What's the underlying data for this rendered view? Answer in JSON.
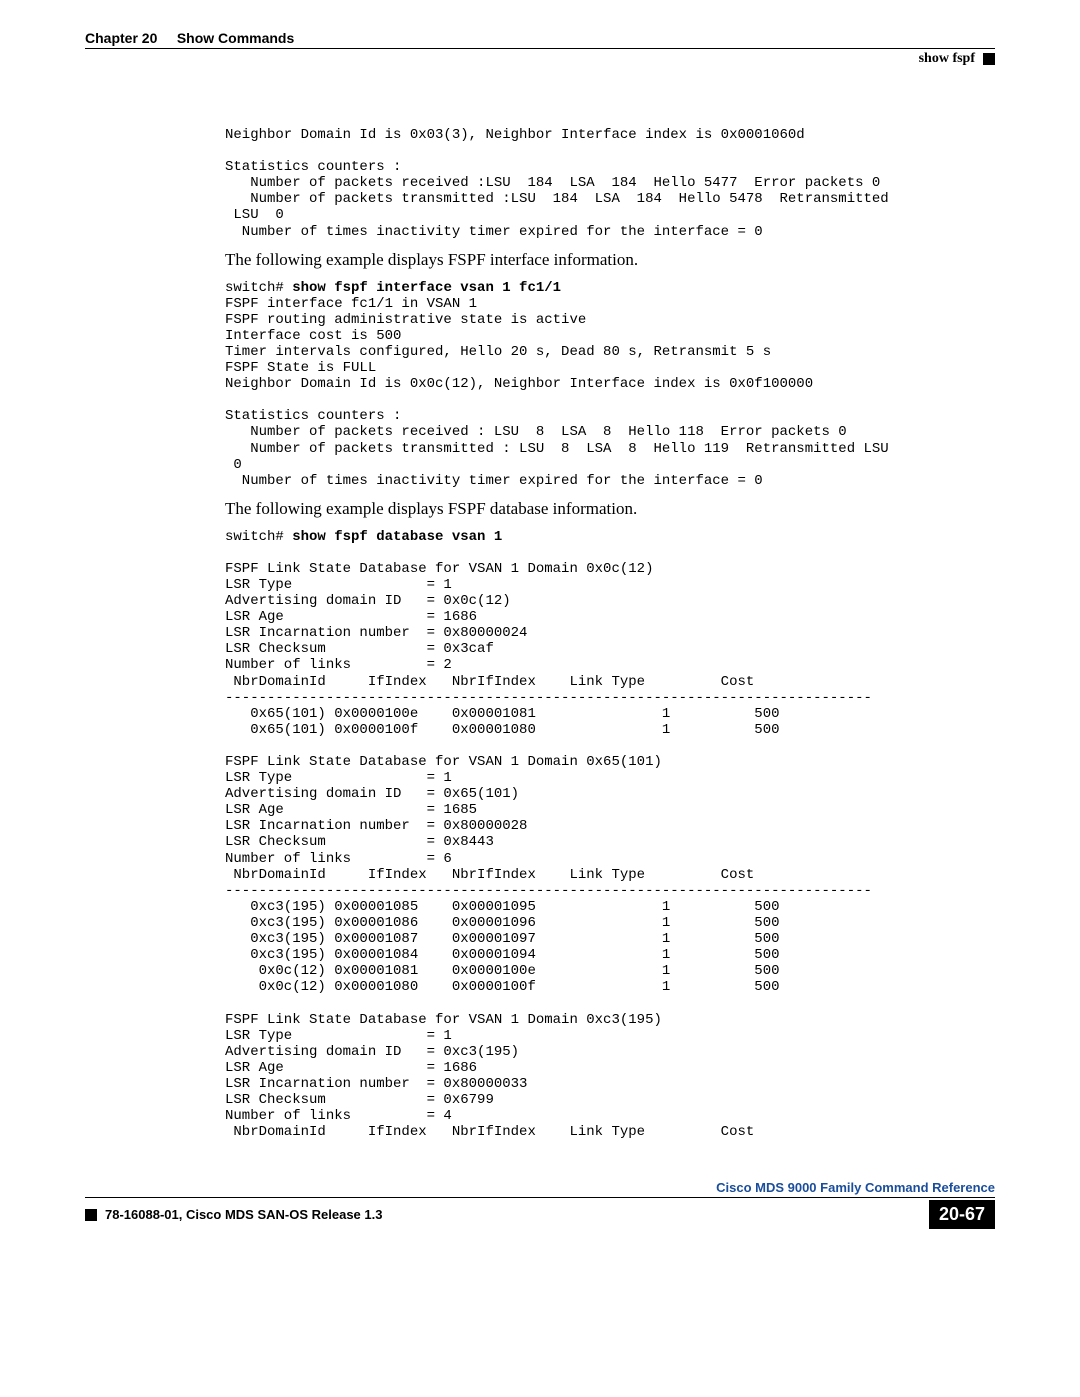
{
  "header": {
    "chapter": "Chapter 20",
    "title": "Show Commands",
    "section": "show fspf"
  },
  "block1": "Neighbor Domain Id is 0x03(3), Neighbor Interface index is 0x0001060d\n\nStatistics counters :\n   Number of packets received :LSU  184  LSA  184  Hello 5477  Error packets 0\n   Number of packets transmitted :LSU  184  LSA  184  Hello 5478  Retransmitted\n LSU  0\n  Number of times inactivity timer expired for the interface = 0",
  "body1": "The following example displays FSPF interface information.",
  "cmd1_prompt": "switch# ",
  "cmd1_cmd": "show fspf interface vsan 1 fc1/1",
  "block2": "FSPF interface fc1/1 in VSAN 1\nFSPF routing administrative state is active\nInterface cost is 500\nTimer intervals configured, Hello 20 s, Dead 80 s, Retransmit 5 s\nFSPF State is FULL\nNeighbor Domain Id is 0x0c(12), Neighbor Interface index is 0x0f100000\n\nStatistics counters :\n   Number of packets received : LSU  8  LSA  8  Hello 118  Error packets 0\n   Number of packets transmitted : LSU  8  LSA  8  Hello 119  Retransmitted LSU\n 0\n  Number of times inactivity timer expired for the interface = 0",
  "body2": "The following example displays FSPF database information.",
  "cmd2_prompt": "switch# ",
  "cmd2_cmd": "show fspf database vsan 1",
  "block3": "\nFSPF Link State Database for VSAN 1 Domain 0x0c(12)\nLSR Type                = 1\nAdvertising domain ID   = 0x0c(12)\nLSR Age                 = 1686\nLSR Incarnation number  = 0x80000024\nLSR Checksum            = 0x3caf\nNumber of links         = 2\n NbrDomainId     IfIndex   NbrIfIndex    Link Type         Cost\n-----------------------------------------------------------------------------\n   0x65(101) 0x0000100e    0x00001081               1          500\n   0x65(101) 0x0000100f    0x00001080               1          500\n\nFSPF Link State Database for VSAN 1 Domain 0x65(101)\nLSR Type                = 1\nAdvertising domain ID   = 0x65(101)\nLSR Age                 = 1685\nLSR Incarnation number  = 0x80000028\nLSR Checksum            = 0x8443\nNumber of links         = 6\n NbrDomainId     IfIndex   NbrIfIndex    Link Type         Cost\n-----------------------------------------------------------------------------\n   0xc3(195) 0x00001085    0x00001095               1          500\n   0xc3(195) 0x00001086    0x00001096               1          500\n   0xc3(195) 0x00001087    0x00001097               1          500\n   0xc3(195) 0x00001084    0x00001094               1          500\n    0x0c(12) 0x00001081    0x0000100e               1          500\n    0x0c(12) 0x00001080    0x0000100f               1          500\n\nFSPF Link State Database for VSAN 1 Domain 0xc3(195)\nLSR Type                = 1\nAdvertising domain ID   = 0xc3(195)\nLSR Age                 = 1686\nLSR Incarnation number  = 0x80000033\nLSR Checksum            = 0x6799\nNumber of links         = 4\n NbrDomainId     IfIndex   NbrIfIndex    Link Type         Cost",
  "footer": {
    "product": "Cisco MDS 9000 Family Command Reference",
    "docid": "78-16088-01, Cisco MDS SAN-OS Release 1.3",
    "page": "20-67"
  }
}
